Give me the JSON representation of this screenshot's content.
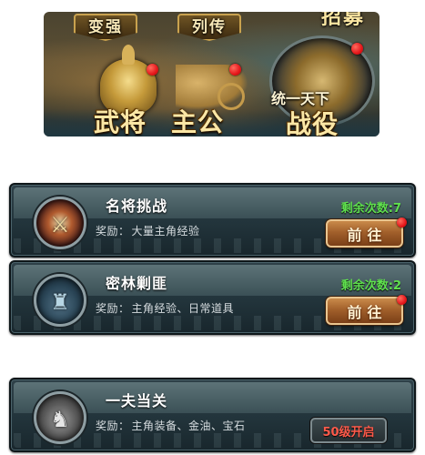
{
  "banner": {
    "tags": [
      "变强",
      "列传",
      "招募"
    ],
    "captions": [
      "武将",
      "主公"
    ],
    "globe_top": "统一天下",
    "globe_main": "战役"
  },
  "tasks": [
    {
      "title": "名将挑战",
      "reward_label": "奖励：",
      "reward_text": "大量主角经验",
      "remaining": "剩余次数:7",
      "button": "前往",
      "icon": "sword-icon"
    },
    {
      "title": "密林剿匪",
      "reward_label": "奖励：",
      "reward_text": "主角经验、日常道具",
      "remaining": "剩余次数:2",
      "button": "前往",
      "icon": "tower-icon"
    },
    {
      "title": "一夫当关",
      "reward_label": "奖励：",
      "reward_text": "主角装备、金油、宝石",
      "locked_label": "50级开启",
      "icon": "warrior-icon"
    }
  ],
  "colors": {
    "remaining": "#5fe04e",
    "locked": "#ff5a4a",
    "notification_dot": "#e5161a",
    "banner_text": "#fbe7a6"
  }
}
